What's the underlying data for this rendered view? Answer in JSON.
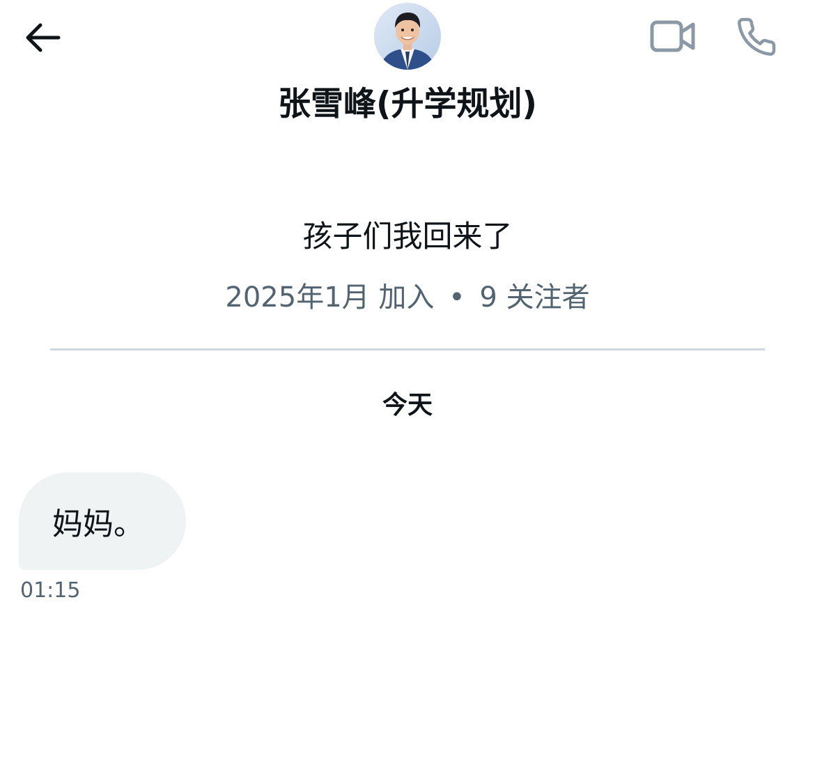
{
  "header": {
    "back_icon": "arrow-left-icon",
    "avatar_icon": "profile-avatar",
    "video_icon": "video-camera-icon",
    "phone_icon": "phone-icon",
    "name": "张雪峰(升学规划)"
  },
  "profile": {
    "bio": "孩子们我回来了",
    "joined": "2025年1月 加入",
    "separator": "•",
    "followers": "9 关注者"
  },
  "conversation": {
    "day_label": "今天",
    "messages": [
      {
        "text": "妈妈。",
        "time": "01:15"
      }
    ]
  },
  "colors": {
    "text_primary": "#0f1419",
    "text_secondary": "#536471",
    "divider": "#cfd9de",
    "bubble_bg": "#eff3f4"
  }
}
